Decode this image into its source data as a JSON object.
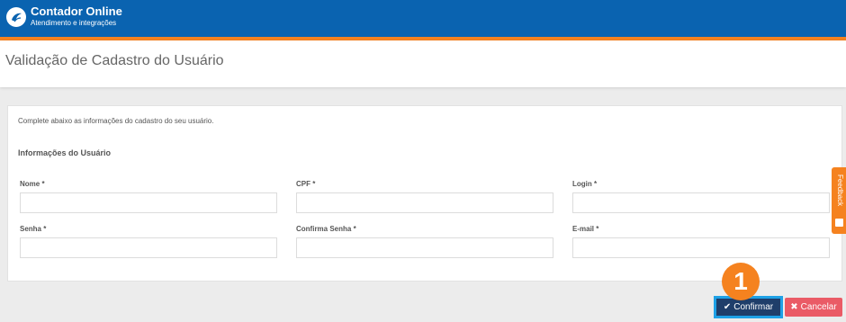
{
  "header": {
    "brand_title": "Contador Online",
    "brand_subtitle": "Atendimento e integrações",
    "logo_icon": "bird-logo-icon",
    "colors": {
      "primary": "#0a63b0",
      "accent": "#f5821f"
    }
  },
  "page": {
    "title": "Validação de Cadastro do Usuário"
  },
  "form": {
    "intro": "Complete abaixo as informações do cadastro do seu usuário.",
    "section_title": "Informações do Usuário",
    "fields": {
      "nome": {
        "label": "Nome *",
        "value": ""
      },
      "cpf": {
        "label": "CPF *",
        "value": ""
      },
      "login": {
        "label": "Login *",
        "value": ""
      },
      "senha": {
        "label": "Senha *",
        "value": ""
      },
      "confirma_senha": {
        "label": "Confirma Senha *",
        "value": ""
      },
      "email": {
        "label": "E-mail *",
        "value": ""
      }
    }
  },
  "feedback": {
    "label": "Feedback",
    "icon": "feedback-icon"
  },
  "actions": {
    "confirm_label": "Confirmar",
    "confirm_icon": "check-icon",
    "cancel_label": "Cancelar",
    "cancel_icon": "close-icon",
    "step_badge": "1",
    "colors": {
      "confirm": "#1f3e6a",
      "cancel": "#ea5b66",
      "highlight": "#1ea1e6",
      "badge": "#f5821f"
    }
  }
}
